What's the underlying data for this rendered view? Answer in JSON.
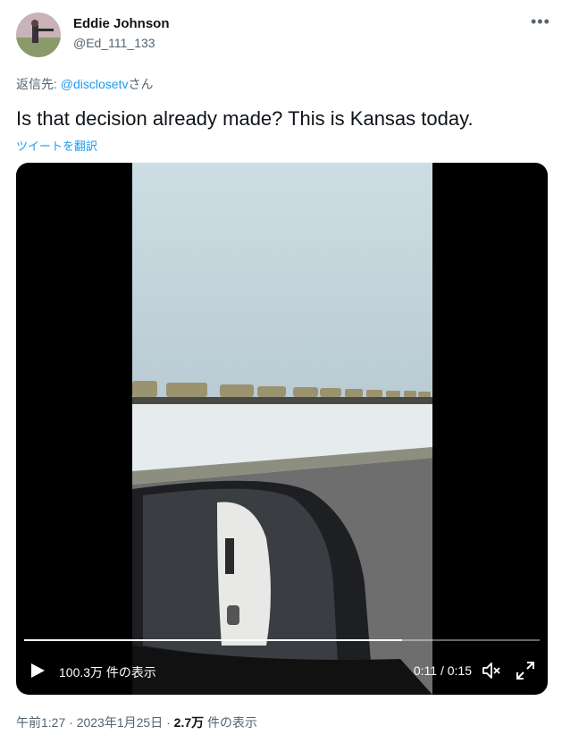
{
  "author": {
    "name": "Eddie Johnson",
    "handle": "@Ed_111_133"
  },
  "reply": {
    "prefix": "返信先: ",
    "mention": "@disclosetv",
    "suffix": "さん"
  },
  "tweet": {
    "text": "Is that decision already made? This is Kansas today.",
    "translate_label": "ツイートを翻訳"
  },
  "video": {
    "views_label": "100.3万 件の表示",
    "time_label": "0:11 / 0:15",
    "progress": 0.733
  },
  "meta": {
    "time": "午前1:27",
    "separator1": " · ",
    "date": "2023年1月25日",
    "separator2": " · ",
    "views_count": "2.7万",
    "views_suffix": " 件の表示"
  },
  "icons": {
    "more": "more-icon",
    "play": "play-icon",
    "volume": "volume-icon",
    "fullscreen": "fullscreen-icon"
  },
  "colors": {
    "link": "#1d9bf0",
    "secondary_text": "#536471",
    "primary_text": "#0f1419"
  }
}
